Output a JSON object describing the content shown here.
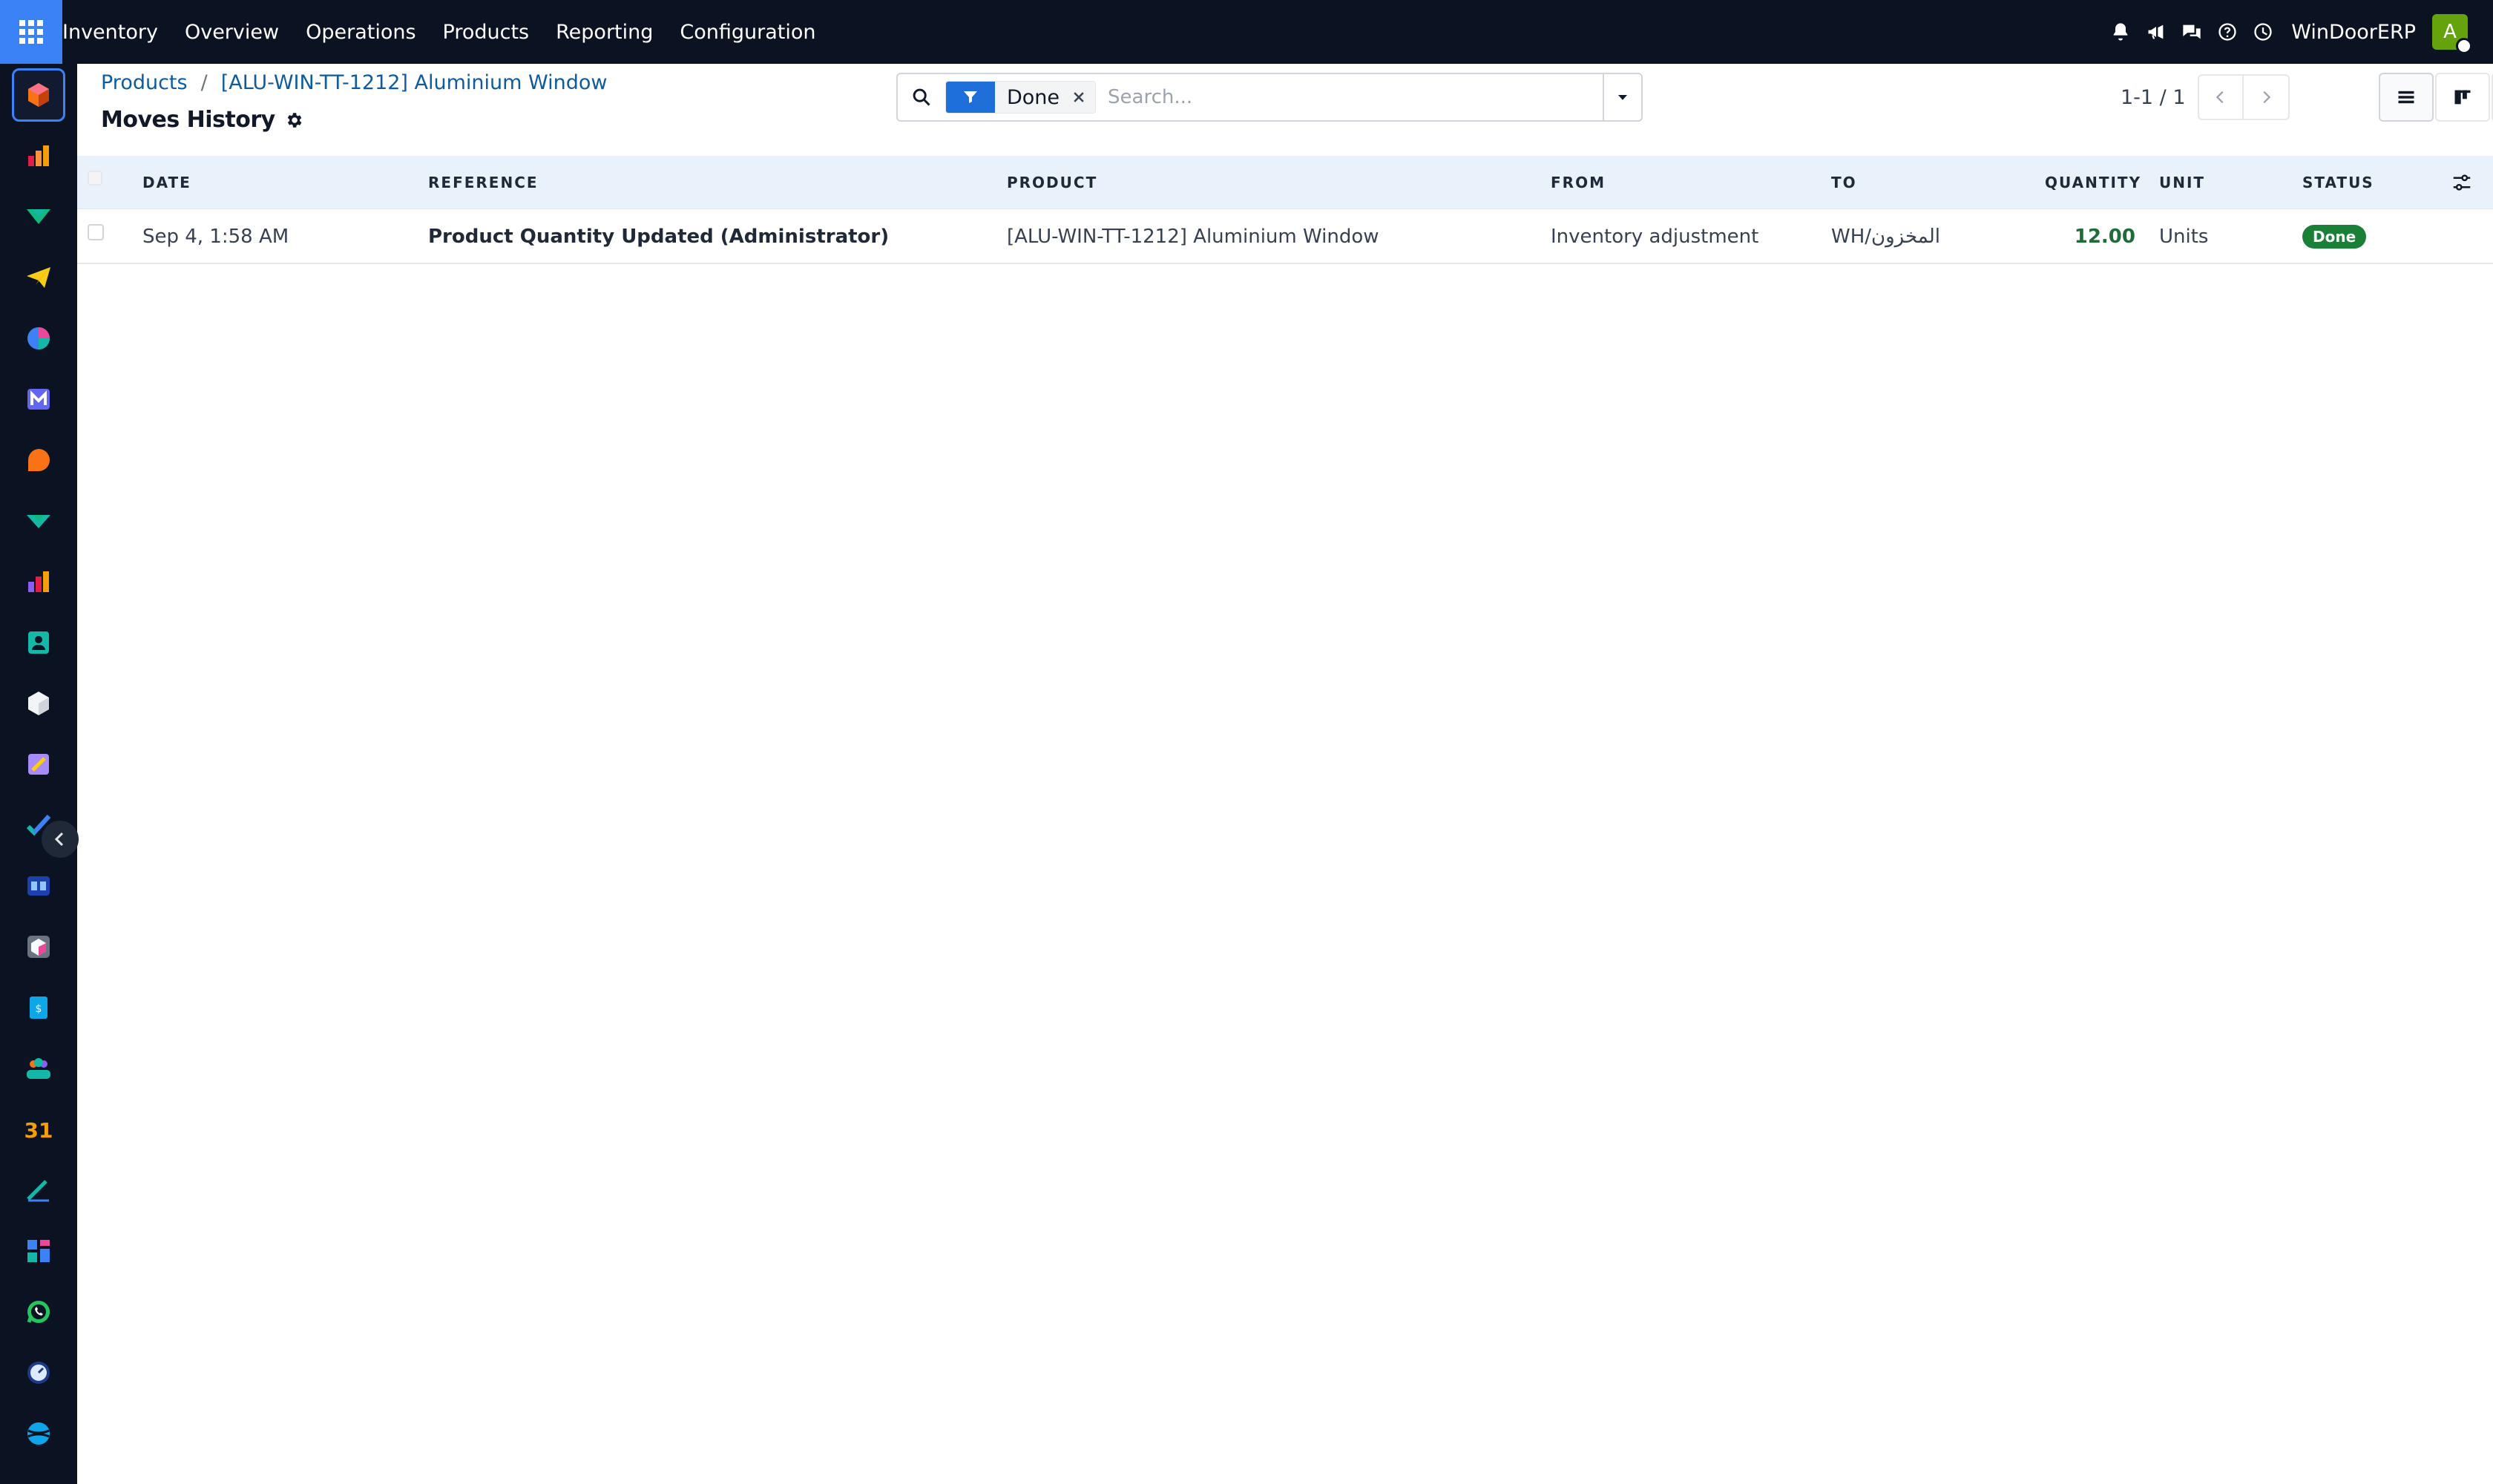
{
  "topbar": {
    "menu": [
      "Inventory",
      "Overview",
      "Operations",
      "Products",
      "Reporting",
      "Configuration"
    ],
    "company": "WinDoorERP",
    "avatar_letter": "A",
    "icons": [
      "bell-icon",
      "megaphone-icon",
      "chat-icon",
      "help-icon",
      "clock-icon"
    ]
  },
  "sidebar": {
    "apps": [
      "inventory-app",
      "sales-app",
      "discuss-app",
      "telegram-app",
      "dashboard-app",
      "email-marketing-app",
      "live-chat-app",
      "discuss2-app",
      "reporting-app",
      "contacts-app",
      "box-app",
      "craft-app",
      "todo-app",
      "knowledge-app",
      "product-app",
      "invoicing-app",
      "employees-app",
      "calendar-app",
      "sign-app",
      "dashboards-app",
      "whatsapp-app",
      "timer-app",
      "website-app"
    ]
  },
  "breadcrumb": {
    "items": [
      "Products",
      "[ALU-WIN-TT-1212] Aluminium Window"
    ],
    "separator": "/"
  },
  "page": {
    "title": "Moves History"
  },
  "search": {
    "facet_value": "Done",
    "placeholder": "Search..."
  },
  "pager": {
    "value": "1-1 / 1"
  },
  "table": {
    "columns": {
      "date": "DATE",
      "reference": "REFERENCE",
      "product": "PRODUCT",
      "from": "FROM",
      "to": "TO",
      "quantity": "QUANTITY",
      "unit": "UNIT",
      "status": "STATUS"
    },
    "rows": [
      {
        "date": "Sep 4, 1:58 AM",
        "reference": "Product Quantity Updated (Administrator)",
        "product": "[ALU-WIN-TT-1212] Aluminium Window",
        "from": "Inventory adjustment",
        "to": "WH/المخزون",
        "quantity": "12.00",
        "unit": "Units",
        "status": "Done"
      }
    ]
  },
  "colors": {
    "navbar": "#0b1221",
    "accent": "#1e6fd9",
    "link": "#0f5b9f",
    "done_badge": "#1a7f37",
    "header_row": "#e9f1fb"
  }
}
